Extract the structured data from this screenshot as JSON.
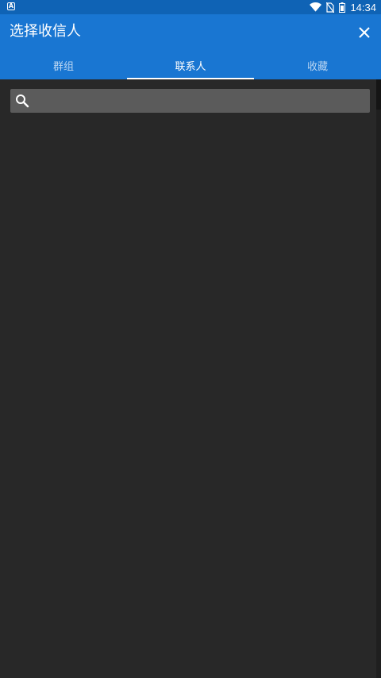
{
  "status_bar": {
    "notification_icon": "a-letter-icon",
    "time": "14:34",
    "icons": [
      "wifi-icon",
      "no-sim-icon",
      "battery-icon"
    ]
  },
  "header": {
    "title": "选择收信人",
    "close_icon": "close-icon"
  },
  "tabs": [
    {
      "label": "群组",
      "active": false
    },
    {
      "label": "联系人",
      "active": true
    },
    {
      "label": "收藏",
      "active": false
    }
  ],
  "search": {
    "placeholder": "",
    "value": "",
    "icon": "search-icon"
  },
  "colors": {
    "status_bar": "#0f63b5",
    "app_bar": "#1976d2",
    "background": "#282828",
    "search_box": "#5b5b5b"
  }
}
